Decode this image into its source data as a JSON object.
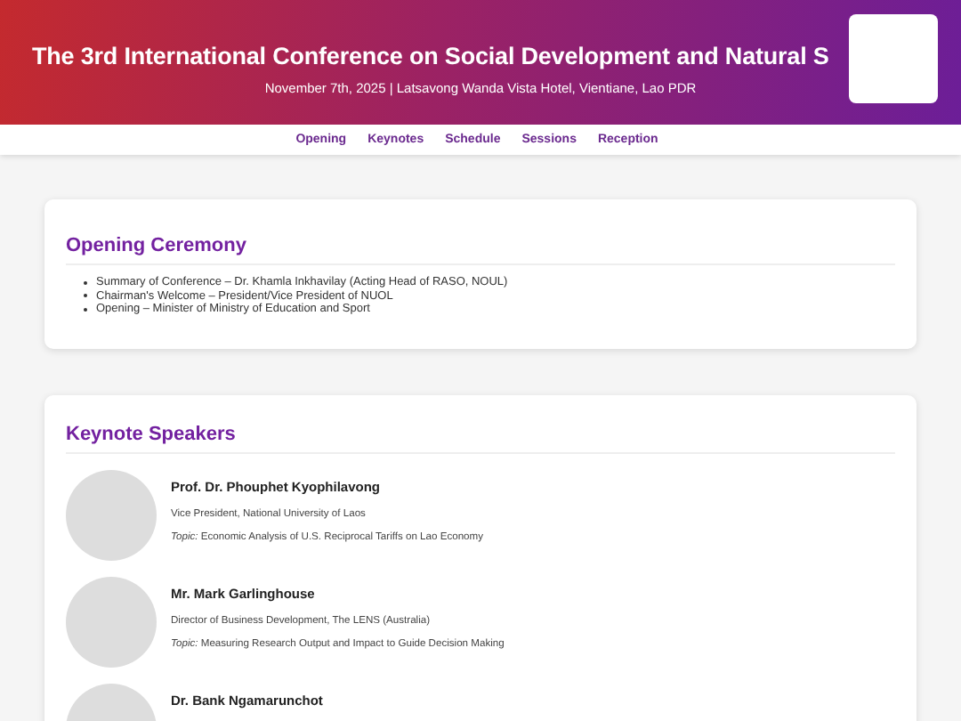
{
  "header": {
    "title": "The 3rd International Conference on Social Development and Natural S",
    "subtitle": "November 7th, 2025 | Latsavong Wanda Vista Hotel, Vientiane, Lao PDR"
  },
  "nav": [
    "Opening",
    "Keynotes",
    "Schedule",
    "Sessions",
    "Reception"
  ],
  "opening": {
    "heading": "Opening Ceremony",
    "items": [
      "Summary of Conference – Dr. Khamla Inkhavilay (Acting Head of RASO, NOUL)",
      "Chairman's Welcome – President/Vice President of NUOL",
      "Opening – Minister of Ministry of Education and Sport"
    ]
  },
  "keynotes": {
    "heading": "Keynote Speakers",
    "speakers": [
      {
        "name": "Prof. Dr. Phouphet Kyophilavong",
        "role": "Vice President, National University of Laos",
        "topic": "*Topic:* Economic Analysis of U.S. Reciprocal Tariffs on Lao Economy"
      },
      {
        "name": "Mr. Mark Garlinghouse",
        "role": "Director of Business Development, The LENS (Australia)",
        "topic": "*Topic:* Measuring Research Output and Impact to Guide Decision Making"
      },
      {
        "name": "Dr. Bank Ngamarunchot"
      }
    ]
  }
}
